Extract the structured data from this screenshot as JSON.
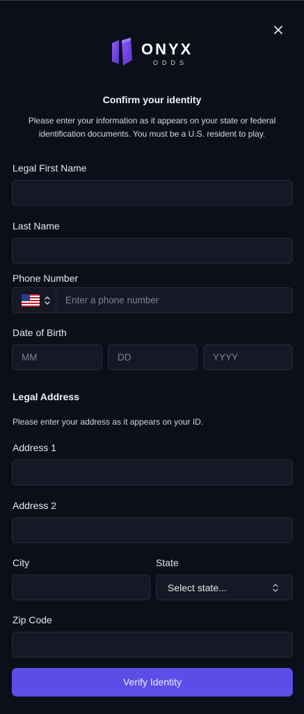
{
  "brand": {
    "name": "ONYX",
    "tagline": "ODDS",
    "accent": "#7b4ff0"
  },
  "dialog": {
    "close_icon": "close-icon",
    "title": "Confirm your identity",
    "description": "Please enter your information as it appears on your state or federal identification documents. You must be a U.S. resident to play."
  },
  "fields": {
    "first_name": {
      "label": "Legal First Name",
      "value": ""
    },
    "last_name": {
      "label": "Last Name",
      "value": ""
    },
    "phone": {
      "label": "Phone Number",
      "placeholder": "Enter a phone number",
      "country_icon": "us-flag-icon"
    },
    "dob": {
      "label": "Date of Birth",
      "month_placeholder": "MM",
      "day_placeholder": "DD",
      "year_placeholder": "YYYY"
    }
  },
  "address": {
    "heading": "Legal Address",
    "instructions": "Please enter your address as it appears on your ID.",
    "address1": {
      "label": "Address 1",
      "value": ""
    },
    "address2": {
      "label": "Address 2",
      "value": ""
    },
    "city": {
      "label": "City",
      "value": ""
    },
    "state": {
      "label": "State",
      "selected": "Select state..."
    },
    "zip": {
      "label": "Zip Code",
      "value": ""
    }
  },
  "submit": {
    "label": "Verify Identity",
    "color": "#5b4ee6"
  }
}
